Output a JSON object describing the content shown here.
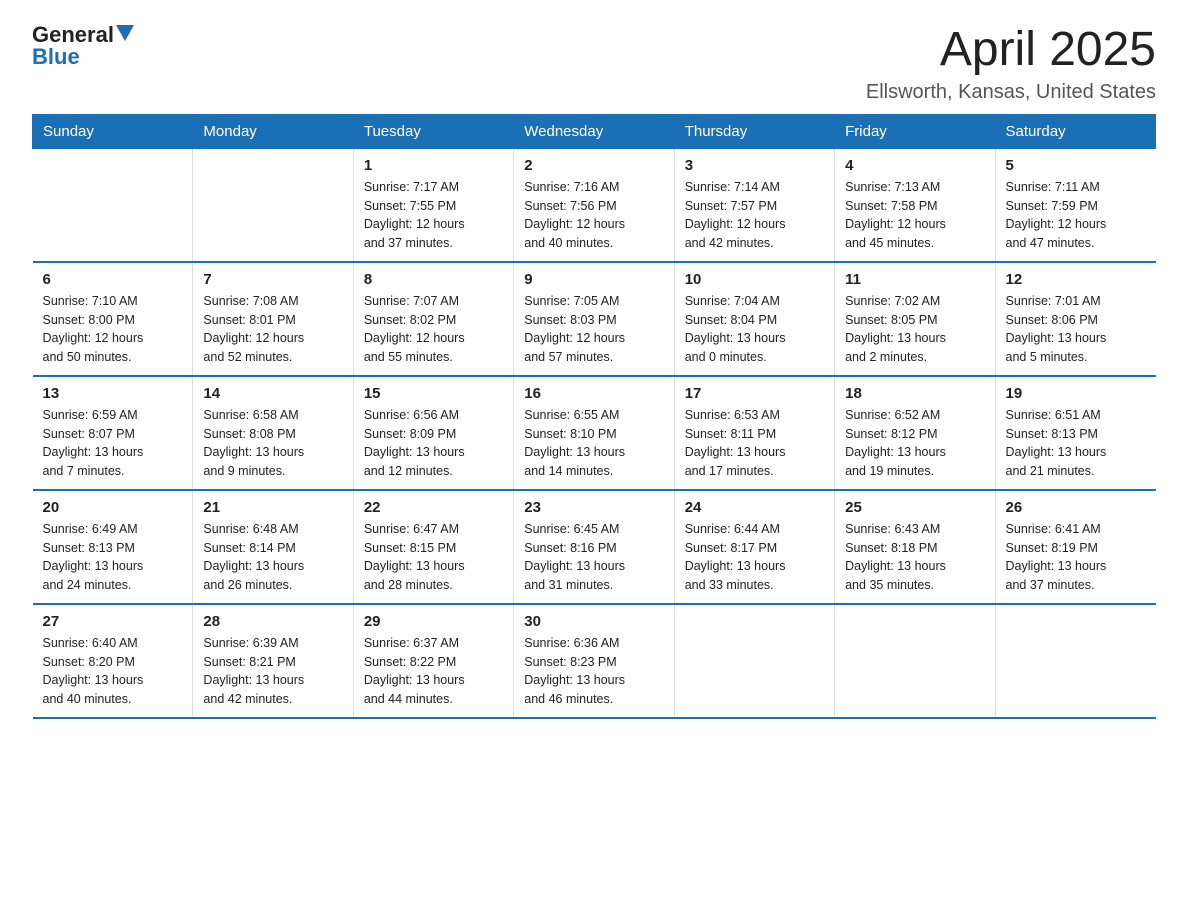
{
  "header": {
    "logo_general": "General",
    "logo_blue": "Blue",
    "title": "April 2025",
    "subtitle": "Ellsworth, Kansas, United States"
  },
  "days_of_week": [
    "Sunday",
    "Monday",
    "Tuesday",
    "Wednesday",
    "Thursday",
    "Friday",
    "Saturday"
  ],
  "weeks": [
    [
      {
        "day": "",
        "info": ""
      },
      {
        "day": "",
        "info": ""
      },
      {
        "day": "1",
        "info": "Sunrise: 7:17 AM\nSunset: 7:55 PM\nDaylight: 12 hours\nand 37 minutes."
      },
      {
        "day": "2",
        "info": "Sunrise: 7:16 AM\nSunset: 7:56 PM\nDaylight: 12 hours\nand 40 minutes."
      },
      {
        "day": "3",
        "info": "Sunrise: 7:14 AM\nSunset: 7:57 PM\nDaylight: 12 hours\nand 42 minutes."
      },
      {
        "day": "4",
        "info": "Sunrise: 7:13 AM\nSunset: 7:58 PM\nDaylight: 12 hours\nand 45 minutes."
      },
      {
        "day": "5",
        "info": "Sunrise: 7:11 AM\nSunset: 7:59 PM\nDaylight: 12 hours\nand 47 minutes."
      }
    ],
    [
      {
        "day": "6",
        "info": "Sunrise: 7:10 AM\nSunset: 8:00 PM\nDaylight: 12 hours\nand 50 minutes."
      },
      {
        "day": "7",
        "info": "Sunrise: 7:08 AM\nSunset: 8:01 PM\nDaylight: 12 hours\nand 52 minutes."
      },
      {
        "day": "8",
        "info": "Sunrise: 7:07 AM\nSunset: 8:02 PM\nDaylight: 12 hours\nand 55 minutes."
      },
      {
        "day": "9",
        "info": "Sunrise: 7:05 AM\nSunset: 8:03 PM\nDaylight: 12 hours\nand 57 minutes."
      },
      {
        "day": "10",
        "info": "Sunrise: 7:04 AM\nSunset: 8:04 PM\nDaylight: 13 hours\nand 0 minutes."
      },
      {
        "day": "11",
        "info": "Sunrise: 7:02 AM\nSunset: 8:05 PM\nDaylight: 13 hours\nand 2 minutes."
      },
      {
        "day": "12",
        "info": "Sunrise: 7:01 AM\nSunset: 8:06 PM\nDaylight: 13 hours\nand 5 minutes."
      }
    ],
    [
      {
        "day": "13",
        "info": "Sunrise: 6:59 AM\nSunset: 8:07 PM\nDaylight: 13 hours\nand 7 minutes."
      },
      {
        "day": "14",
        "info": "Sunrise: 6:58 AM\nSunset: 8:08 PM\nDaylight: 13 hours\nand 9 minutes."
      },
      {
        "day": "15",
        "info": "Sunrise: 6:56 AM\nSunset: 8:09 PM\nDaylight: 13 hours\nand 12 minutes."
      },
      {
        "day": "16",
        "info": "Sunrise: 6:55 AM\nSunset: 8:10 PM\nDaylight: 13 hours\nand 14 minutes."
      },
      {
        "day": "17",
        "info": "Sunrise: 6:53 AM\nSunset: 8:11 PM\nDaylight: 13 hours\nand 17 minutes."
      },
      {
        "day": "18",
        "info": "Sunrise: 6:52 AM\nSunset: 8:12 PM\nDaylight: 13 hours\nand 19 minutes."
      },
      {
        "day": "19",
        "info": "Sunrise: 6:51 AM\nSunset: 8:13 PM\nDaylight: 13 hours\nand 21 minutes."
      }
    ],
    [
      {
        "day": "20",
        "info": "Sunrise: 6:49 AM\nSunset: 8:13 PM\nDaylight: 13 hours\nand 24 minutes."
      },
      {
        "day": "21",
        "info": "Sunrise: 6:48 AM\nSunset: 8:14 PM\nDaylight: 13 hours\nand 26 minutes."
      },
      {
        "day": "22",
        "info": "Sunrise: 6:47 AM\nSunset: 8:15 PM\nDaylight: 13 hours\nand 28 minutes."
      },
      {
        "day": "23",
        "info": "Sunrise: 6:45 AM\nSunset: 8:16 PM\nDaylight: 13 hours\nand 31 minutes."
      },
      {
        "day": "24",
        "info": "Sunrise: 6:44 AM\nSunset: 8:17 PM\nDaylight: 13 hours\nand 33 minutes."
      },
      {
        "day": "25",
        "info": "Sunrise: 6:43 AM\nSunset: 8:18 PM\nDaylight: 13 hours\nand 35 minutes."
      },
      {
        "day": "26",
        "info": "Sunrise: 6:41 AM\nSunset: 8:19 PM\nDaylight: 13 hours\nand 37 minutes."
      }
    ],
    [
      {
        "day": "27",
        "info": "Sunrise: 6:40 AM\nSunset: 8:20 PM\nDaylight: 13 hours\nand 40 minutes."
      },
      {
        "day": "28",
        "info": "Sunrise: 6:39 AM\nSunset: 8:21 PM\nDaylight: 13 hours\nand 42 minutes."
      },
      {
        "day": "29",
        "info": "Sunrise: 6:37 AM\nSunset: 8:22 PM\nDaylight: 13 hours\nand 44 minutes."
      },
      {
        "day": "30",
        "info": "Sunrise: 6:36 AM\nSunset: 8:23 PM\nDaylight: 13 hours\nand 46 minutes."
      },
      {
        "day": "",
        "info": ""
      },
      {
        "day": "",
        "info": ""
      },
      {
        "day": "",
        "info": ""
      }
    ]
  ]
}
